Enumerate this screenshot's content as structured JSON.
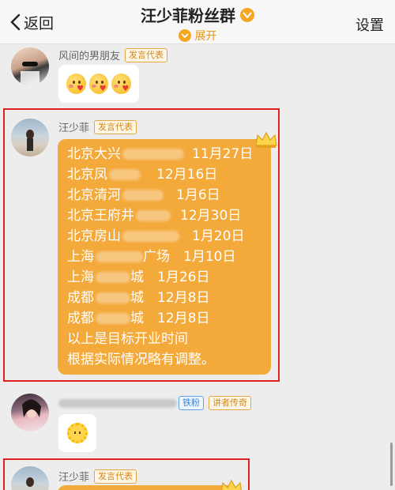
{
  "header": {
    "back_label": "返回",
    "title": "汪少菲粉丝群",
    "expand_label": "展开",
    "settings_label": "设置"
  },
  "messages": [
    {
      "sender": "风间的男朋友",
      "tag": "发言代表",
      "content": "emoji-row"
    },
    {
      "sender": "汪少菲",
      "tag": "发言代表",
      "lines": [
        {
          "pre": "北京大兴",
          "post": "11月27日"
        },
        {
          "pre": "北京凤",
          "post": "12月16日"
        },
        {
          "pre": "北京清河",
          "post": "1月6日"
        },
        {
          "pre": "北京王府井",
          "post": "12月30日"
        },
        {
          "pre": "北京房山",
          "post": "1月20日"
        },
        {
          "pre": "上海",
          "post": "广场　1月10日"
        },
        {
          "pre": "上海",
          "post": "城　1月26日"
        },
        {
          "pre": "成都",
          "post": "城　12月8日"
        },
        {
          "pre": "成都",
          "post": "城　12月8日"
        },
        {
          "pre": "以上是目标开业时间",
          "post": ""
        },
        {
          "pre": "根据实际情况略有调整。",
          "post": ""
        }
      ]
    },
    {
      "sender_blurred": true,
      "tag1": "铁粉",
      "tag2": "讲者传奇",
      "content": "sun-emoji"
    },
    {
      "sender": "汪少菲",
      "tag": "发言代表"
    }
  ],
  "colors": {
    "accent_orange": "#f4a93b",
    "highlight_red": "#e02020",
    "tag_orange": "#d48a1e",
    "tag_blue": "#3a86d4"
  }
}
